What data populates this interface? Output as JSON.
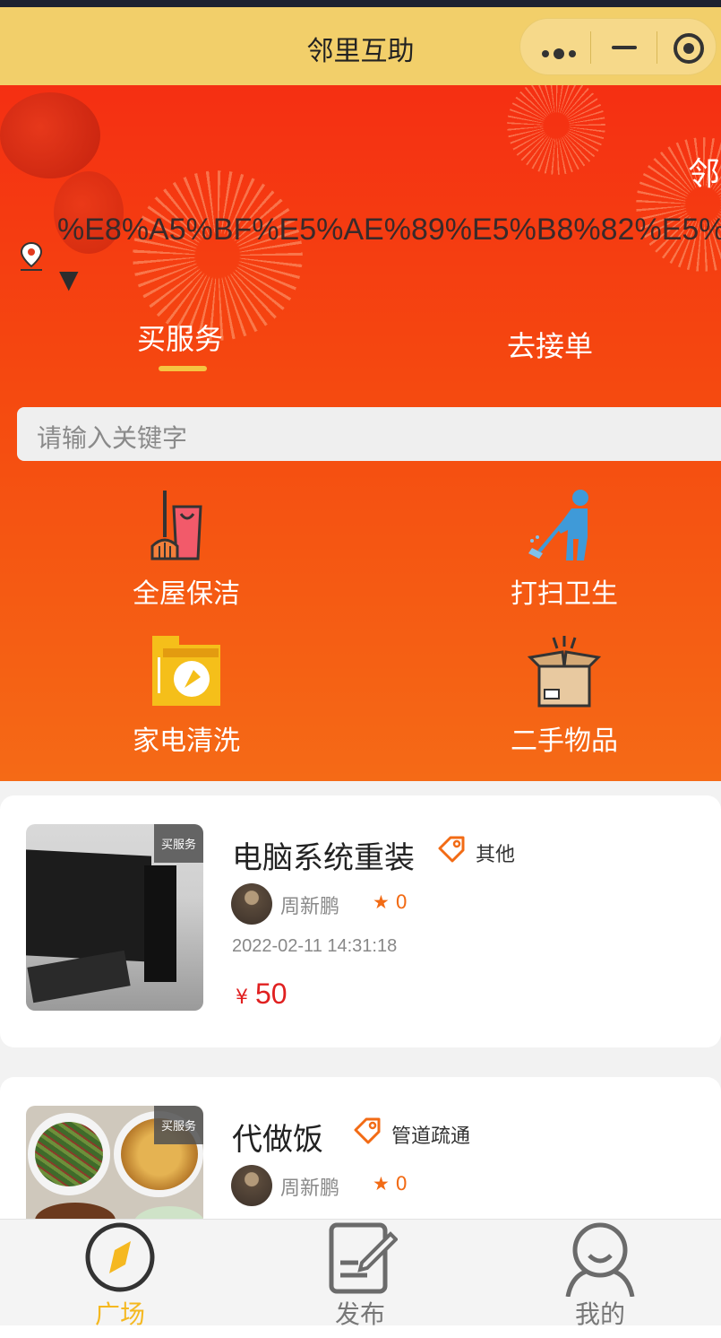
{
  "app": {
    "title": "邻里互助"
  },
  "capsule": {
    "more_icon": "more-dots-icon",
    "minimize_icon": "minimize-icon",
    "close_icon": "target-icon"
  },
  "hero": {
    "corner_text": "邻",
    "location": "%E8%A5%BF%E5%AE%89%E5%B8%82%E5%",
    "location_arrow": "▼",
    "tabs": [
      {
        "label": "买服务",
        "active": true
      },
      {
        "label": "去接单",
        "active": false
      }
    ],
    "search": {
      "placeholder": "请输入关键字"
    },
    "categories": [
      {
        "label": "全屋保洁",
        "icon": "broom-bucket-icon"
      },
      {
        "label": "打扫卫生",
        "icon": "cleaner-person-icon"
      },
      {
        "label": "家电清洗",
        "icon": "washing-machine-icon"
      },
      {
        "label": "二手物品",
        "icon": "open-box-icon"
      }
    ]
  },
  "listings": [
    {
      "badge": "买服务",
      "title": "电脑系统重装",
      "tag": "其他",
      "user": "周新鹏",
      "rating": "★ 0",
      "time": "2022-02-11 14:31:18",
      "currency": "¥",
      "price": "50"
    },
    {
      "badge": "买服务",
      "title": "代做饭",
      "tag": "管道疏通",
      "user": "周新鹏",
      "rating": "★ 0"
    }
  ],
  "tabbar": {
    "items": [
      {
        "label": "广场",
        "icon": "compass-icon",
        "active": true
      },
      {
        "label": "发布",
        "icon": "edit-note-icon",
        "active": false
      },
      {
        "label": "我的",
        "icon": "user-icon",
        "active": false
      }
    ],
    "active_color": "#f5b820",
    "inactive_color": "#777777"
  },
  "colors": {
    "accent": "#f26b15",
    "price": "#e02020",
    "header": "#f2cf6a"
  }
}
